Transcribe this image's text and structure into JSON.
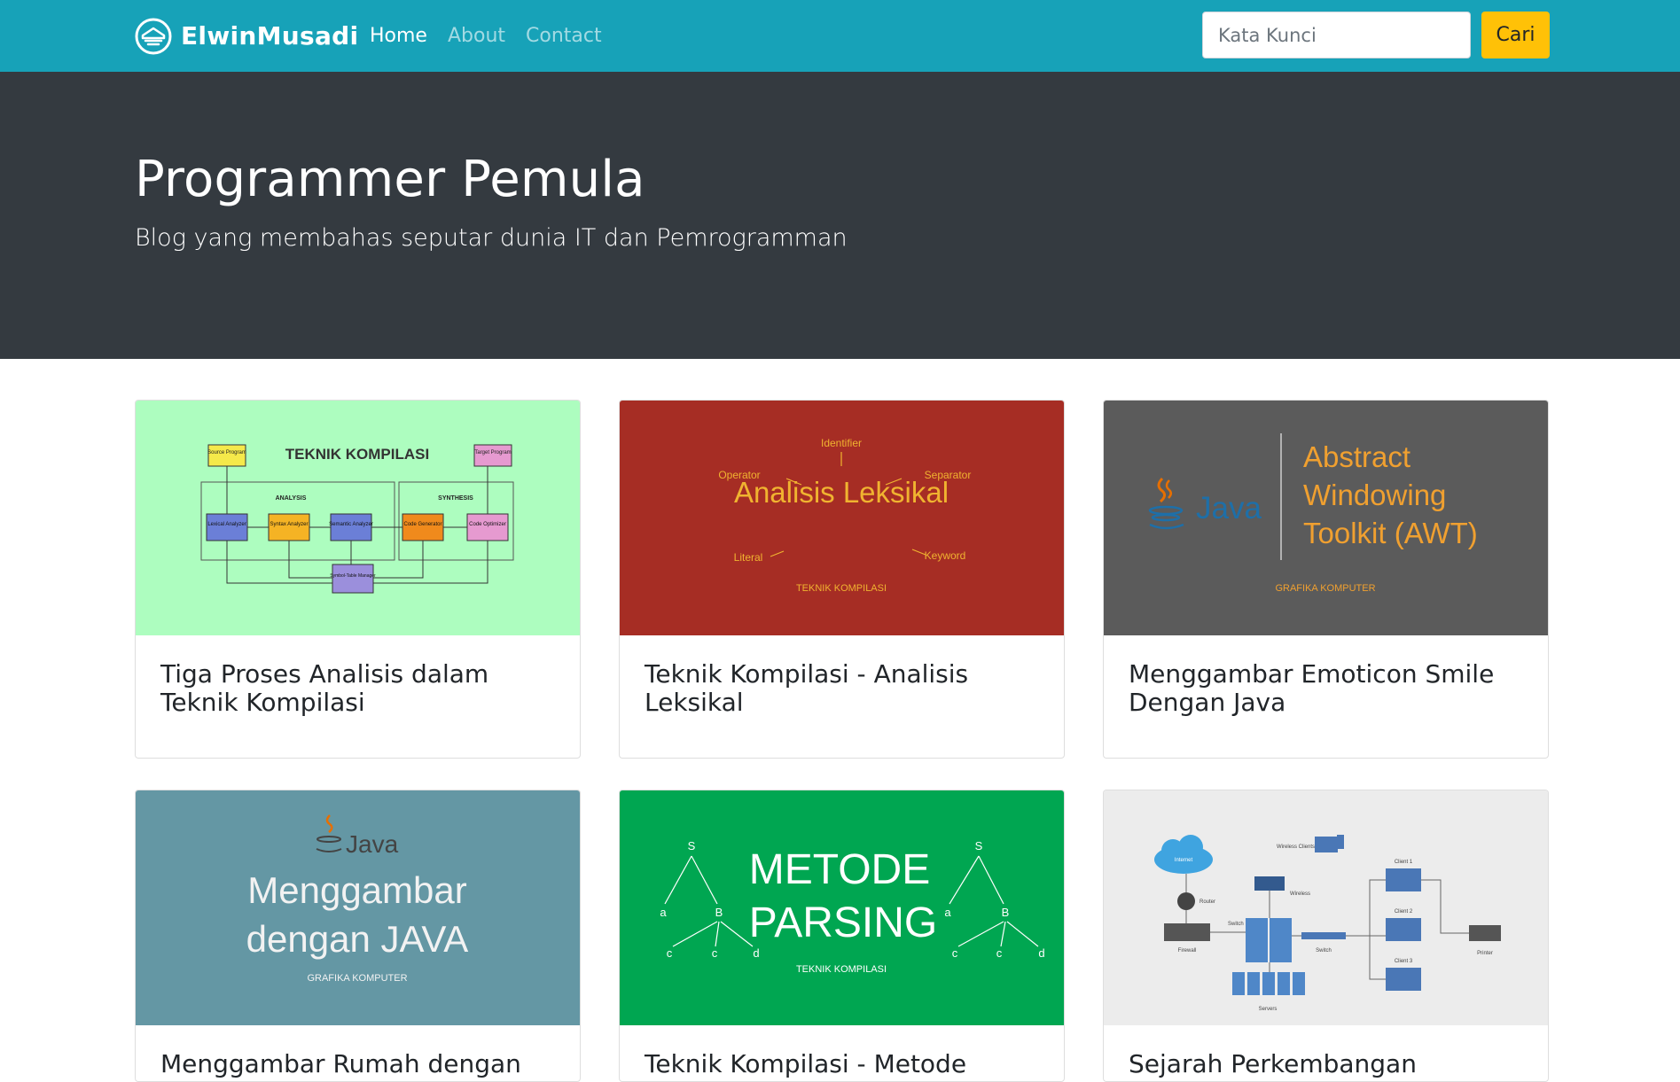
{
  "navbar": {
    "brand": "ElwinMusadi",
    "links": [
      {
        "label": "Home",
        "active": true
      },
      {
        "label": "About",
        "active": false
      },
      {
        "label": "Contact",
        "active": false
      }
    ],
    "search": {
      "placeholder": "Kata Kunci",
      "value": ""
    },
    "search_button": "Cari",
    "colors": {
      "navbar_bg": "#17a2b8",
      "button_bg": "#ffc107"
    }
  },
  "hero": {
    "title": "Programmer Pemula",
    "lead": "Blog yang membahas seputar dunia IT dan Pemrogramman",
    "bg": "#343a40"
  },
  "posts": [
    {
      "title": "Tiga Proses Analisis dalam Teknik Kompilasi",
      "image": {
        "bg": "#adfdbf",
        "heading": "TEKNIK KOMPILASI",
        "boxes": [
          "Source Program",
          "Target Program",
          "Lexical Analyzer",
          "Syntax Analyzer",
          "Semantic Analyzer",
          "Code Generator",
          "Code Optimizer",
          "Symbol-Table Manager"
        ],
        "group_labels": [
          "ANALYSIS",
          "SYNTHESIS"
        ]
      }
    },
    {
      "title": "Teknik Kompilasi - Analisis Leksikal",
      "image": {
        "bg": "#a62d24",
        "heading": "Analisis Leksikal",
        "terms": [
          "Identifier",
          "Operator",
          "Separator",
          "Literal",
          "Keyword"
        ],
        "footer": "TEKNIK KOMPILASI"
      }
    },
    {
      "title": "Menggambar Emoticon Smile Dengan Java",
      "image": {
        "bg": "#5b5b5b",
        "logo": "Java",
        "heading": "Abstract Windowing Toolkit (AWT)",
        "footer": "GRAFIKA KOMPUTER"
      }
    },
    {
      "title": "Menggambar Rumah dengan Java",
      "image": {
        "bg": "#6497a4",
        "logo": "Java",
        "heading": "Menggambar dengan JAVA",
        "footer": "GRAFIKA KOMPUTER"
      }
    },
    {
      "title": "Teknik Kompilasi - Metode Parsing",
      "image": {
        "bg": "#00a651",
        "heading": "METODE PARSING",
        "tree_labels": [
          "S",
          "a",
          "B",
          "c",
          "c",
          "d"
        ],
        "footer": "TEKNIK KOMPILASI"
      }
    },
    {
      "title": "Sejarah Perkembangan Jaringan",
      "image": {
        "bg": "#ececec",
        "labels": [
          "Internet",
          "Router",
          "Firewall",
          "Switch",
          "Wireless Clients",
          "Wireless",
          "Switch",
          "Servers",
          "Client 1",
          "Client 2",
          "Client 3",
          "Printer"
        ]
      }
    }
  ]
}
